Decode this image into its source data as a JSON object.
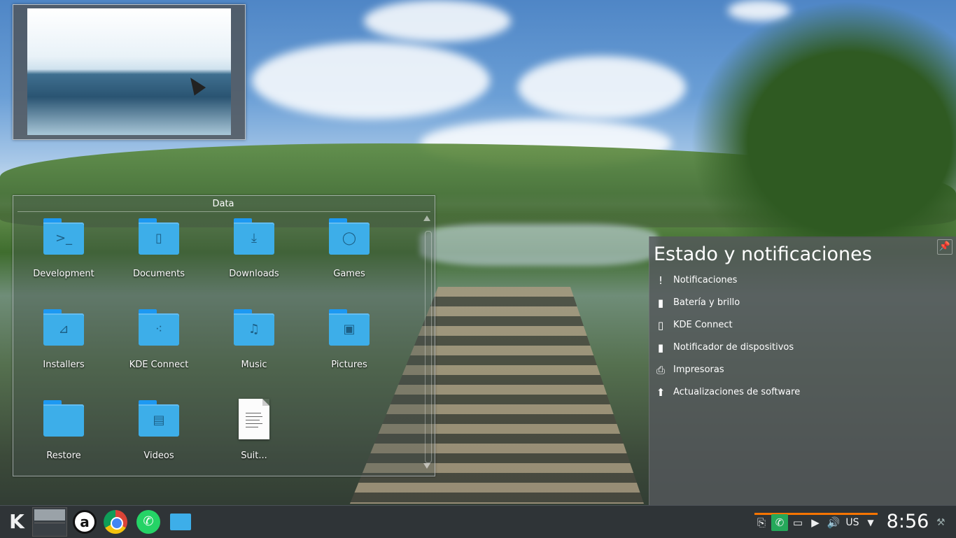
{
  "thumbnail": {},
  "folder_view": {
    "title": "Data",
    "items": [
      {
        "label": "Development",
        "icon": "folder-development-icon",
        "glyph": ">_"
      },
      {
        "label": "Documents",
        "icon": "folder-documents-icon",
        "glyph": "▯"
      },
      {
        "label": "Downloads",
        "icon": "folder-downloads-icon",
        "glyph": "⤓"
      },
      {
        "label": "Games",
        "icon": "folder-games-icon",
        "glyph": "◯"
      },
      {
        "label": "Installers",
        "icon": "folder-installers-icon",
        "glyph": "⊿"
      },
      {
        "label": "KDE Connect",
        "icon": "folder-kdeconnect-icon",
        "glyph": "⁖"
      },
      {
        "label": "Music",
        "icon": "folder-music-icon",
        "glyph": "♫"
      },
      {
        "label": "Pictures",
        "icon": "folder-pictures-icon",
        "glyph": "▣"
      },
      {
        "label": "Restore",
        "icon": "folder-icon",
        "glyph": ""
      },
      {
        "label": "Videos",
        "icon": "folder-videos-icon",
        "glyph": "▤"
      },
      {
        "label": "Suit...",
        "icon": "text-document-icon",
        "glyph": ""
      }
    ]
  },
  "notifications": {
    "title": "Estado y notificaciones",
    "items": [
      {
        "label": "Notificaciones",
        "icon": "notifications-icon",
        "glyph": "!"
      },
      {
        "label": "Batería y brillo",
        "icon": "battery-icon",
        "glyph": "▮"
      },
      {
        "label": "KDE Connect",
        "icon": "phone-icon",
        "glyph": "▯"
      },
      {
        "label": "Notificador de dispositivos",
        "icon": "device-notifier-icon",
        "glyph": "▮"
      },
      {
        "label": "Impresoras",
        "icon": "printer-icon",
        "glyph": "⎙"
      },
      {
        "label": "Actualizaciones de software",
        "icon": "software-updates-icon",
        "glyph": "⬆"
      }
    ]
  },
  "taskbar": {
    "launcher_icon": "kde-logo-icon",
    "apps": [
      "anydesk-icon",
      "chrome-icon",
      "whatsapp-icon",
      "file-manager-icon"
    ],
    "tray": {
      "keyboard_layout": "US",
      "clock": "8:56"
    }
  },
  "colors": {
    "accent": "#3daee9",
    "tray_highlight": "#f67400",
    "panel": "#2f3437"
  }
}
